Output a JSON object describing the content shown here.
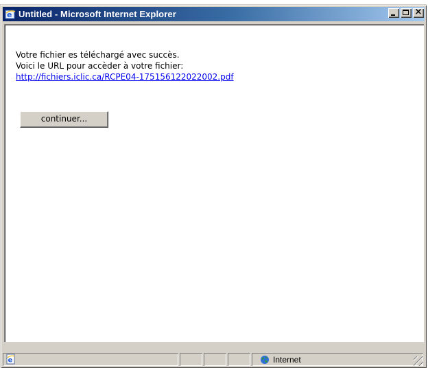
{
  "window": {
    "title": "Untitled - Microsoft Internet Explorer",
    "icon": "ie-logo-icon"
  },
  "caption_buttons": [
    "minimize-icon",
    "maximize-icon",
    "close-icon"
  ],
  "content": {
    "line1": "Votre fichier es téléchargé avec succès.",
    "line2": "Voici le URL pour accèder à votre fichier:",
    "link": "http://fichiers.iclic.ca/RCPE04-175156122022002.pdf",
    "continue_label": "continuer..."
  },
  "statusbar": {
    "zone_label": "Internet",
    "page_icon": "ie-page-icon",
    "zone_icon": "globe-icon"
  },
  "colors": {
    "titlebar_start": "#0a246a",
    "titlebar_end": "#a6caf0",
    "link": "#0000ee",
    "chrome": "#d4d0c8"
  }
}
